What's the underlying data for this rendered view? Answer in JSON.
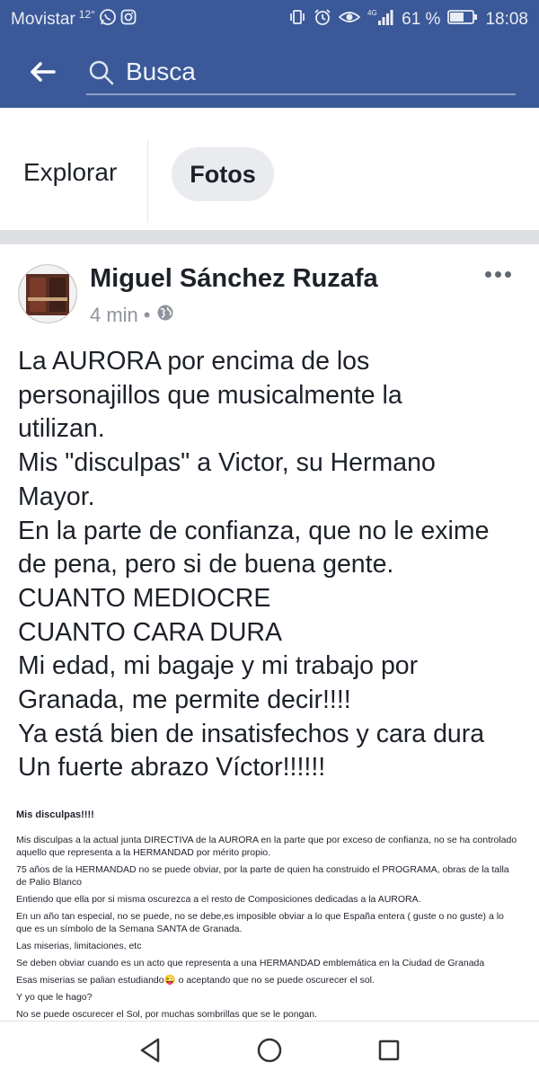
{
  "status_bar": {
    "carrier": "Movistar",
    "temperature": "12°",
    "network": "4G",
    "battery_percent": "61 %",
    "time": "18:08"
  },
  "app_bar": {
    "search_placeholder": "Busca"
  },
  "tabs": {
    "explore_label": "Explorar",
    "photos_label": "Fotos"
  },
  "post": {
    "author": "Miguel Sánchez Ruzafa",
    "time_ago": "4 min",
    "separator": "•",
    "lines": [
      "La AURORA por encima de los",
      "personajillos que musicalmente la",
      "utilizan.",
      "Mis \"disculpas\" a Victor, su Hermano",
      "Mayor.",
      "En la parte de confianza, que no le exime",
      "de pena, pero si de buena gente.",
      "CUANTO MEDIOCRE",
      "CUANTO CARA DURA",
      "Mi edad, mi bagaje y mi trabajo por",
      "Granada, me permite decir!!!!",
      "Ya está bien de insatisfechos y cara dura",
      "Un fuerte abrazo Víctor!!!!!!"
    ]
  },
  "attachment": {
    "title": "Mis disculpas!!!!",
    "paragraphs": [
      " Mis disculpas a la actual junta DIRECTIVA de la AURORA en la parte que por exceso de confianza, no se ha controlado aquello que representa a la HERMANDAD por mérito propio.",
      "75 años de la HERMANDAD no se puede obviar, por la parte de quien ha construido el PROGRAMA, obras de la talla de Palio Blanco",
      "Entiendo que ella por si misma oscurezca a el resto de Composiciones dedicadas a la AURORA.",
      "En un año tan especial, no se puede, no se debe,es imposible obviar a lo que  España entera ( guste o no guste) a lo que es un símbolo de la Semana SANTA de Granada.",
      "Las miserias, limitaciones, etc",
      "Se deben obviar cuando es un acto que representa a una HERMANDAD emblemática en la Ciudad de Granada",
      "Esas miserias se palian estudiando😜 o aceptando que no se puede oscurecer el sol.",
      "Y yo que le hago?",
      "No se puede oscurecer el Sol, por muchas sombrillas que se le pongan."
    ]
  },
  "colors": {
    "facebook_blue": "#3b5998",
    "text_primary": "#1d2129",
    "text_secondary": "#90949c",
    "separator_gray": "#dddfe2"
  },
  "icons": [
    "whatsapp-icon",
    "instagram-icon",
    "vibrate-icon",
    "alarm-icon",
    "eye-icon",
    "signal-icon",
    "battery-icon",
    "back-arrow-icon",
    "search-icon",
    "globe-icon",
    "more-options-icon",
    "nav-back-icon",
    "nav-home-icon",
    "nav-recents-icon"
  ]
}
